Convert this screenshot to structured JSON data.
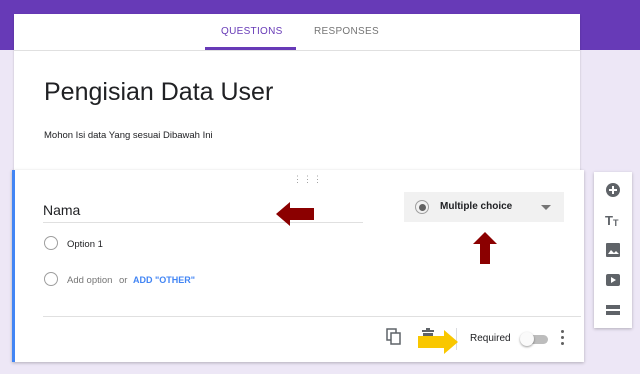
{
  "tabs": {
    "questions": "QUESTIONS",
    "responses": "RESPONSES"
  },
  "form": {
    "title": "Pengisian Data User",
    "description": "Mohon Isi data Yang sesuai Dibawah Ini"
  },
  "question": {
    "title": "Nama",
    "type_label": "Multiple choice",
    "options": [
      "Option 1"
    ],
    "add_option": "Add option",
    "or_label": "or",
    "add_other": "ADD \"OTHER\"",
    "required_label": "Required",
    "required": false
  },
  "side_tools": [
    "add-question-icon",
    "title-text-icon",
    "image-icon",
    "video-icon",
    "section-icon"
  ],
  "colors": {
    "accent": "#673ab7",
    "focus_border": "#4285f4",
    "annotation_red": "#8b0000",
    "annotation_yellow": "#f9c700"
  }
}
